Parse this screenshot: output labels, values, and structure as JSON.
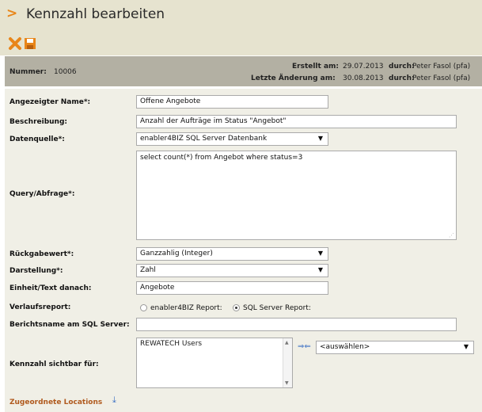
{
  "header": {
    "title": "Kennzahl bearbeiten"
  },
  "toolbar": {
    "cancel_icon": "cancel-x-icon",
    "save_icon": "save-disk-icon"
  },
  "info": {
    "number_label": "Nummer:",
    "number_value": "10006",
    "created_label": "Erstellt am:",
    "created_date": "29.07.2013",
    "created_by_label": "durch:",
    "created_by": "Peter Fasol (pfa)",
    "changed_label": "Letzte Änderung am:",
    "changed_date": "30.08.2013",
    "changed_by_label": "durch:",
    "changed_by": "Peter Fasol (pfa)"
  },
  "form": {
    "display_name_label": "Angezeigter Name*:",
    "display_name_value": "Offene Angebote",
    "description_label": "Beschreibung:",
    "description_value": "Anzahl der Aufträge im Status \"Angebot\"",
    "datasource_label": "Datenquelle*:",
    "datasource_value": "enabler4BIZ SQL Server Datenbank",
    "query_label": "Query/Abfrage*:",
    "query_value": "select count(*) from Angebot where status=3",
    "return_label": "Rückgabewert*:",
    "return_value": "Ganzzahlig (Integer)",
    "display_label": "Darstellung*:",
    "display_value": "Zahl",
    "unit_label": "Einheit/Text danach:",
    "unit_value": "Angebote",
    "history_label": "Verlaufsreport:",
    "history_opt1": "enabler4BIZ Report:",
    "history_opt2": "SQL Server Report:",
    "history_selected": "SQL Server Report:",
    "report_name_label": "Berichtsname am SQL Server:",
    "report_name_value": "",
    "visible_label": "Kennzahl sichtbar für:",
    "visible_items": [
      "REWATECH Users"
    ],
    "visible_select": "<auswählen>"
  },
  "footer": {
    "locations_link": "Zugeordnete Locations"
  }
}
